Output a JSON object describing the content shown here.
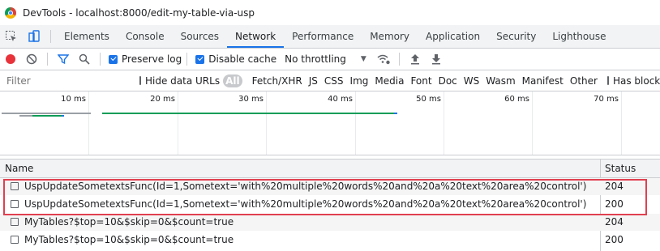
{
  "window": {
    "title": "DevTools - localhost:8000/edit-my-table-via-usp"
  },
  "tabs": [
    {
      "label": "Elements"
    },
    {
      "label": "Console"
    },
    {
      "label": "Sources"
    },
    {
      "label": "Network",
      "active": true
    },
    {
      "label": "Performance"
    },
    {
      "label": "Memory"
    },
    {
      "label": "Application"
    },
    {
      "label": "Security"
    },
    {
      "label": "Lighthouse"
    }
  ],
  "toolbar": {
    "preserve_log": {
      "label": "Preserve log",
      "checked": true
    },
    "disable_cache": {
      "label": "Disable cache",
      "checked": true
    },
    "throttling": "No throttling"
  },
  "filter": {
    "placeholder": "Filter",
    "hide_data_urls": {
      "label": "Hide data URLs",
      "checked": false
    },
    "types": [
      "All",
      "Fetch/XHR",
      "JS",
      "CSS",
      "Img",
      "Media",
      "Font",
      "Doc",
      "WS",
      "Wasm",
      "Manifest",
      "Other"
    ],
    "has_blocked": {
      "label": "Has block",
      "checked": false
    }
  },
  "overview": {
    "ticks": [
      "10 ms",
      "20 ms",
      "30 ms",
      "40 ms",
      "50 ms",
      "60 ms",
      "70 ms"
    ]
  },
  "table": {
    "headers": {
      "name": "Name",
      "status": "Status"
    },
    "rows": [
      {
        "name": "UspUpdateSometextsFunc(Id=1,Sometext='with%20multiple%20words%20and%20a%20text%20area%20control')",
        "status": "204"
      },
      {
        "name": "UspUpdateSometextsFunc(Id=1,Sometext='with%20multiple%20words%20and%20a%20text%20area%20control')",
        "status": "200"
      },
      {
        "name": "MyTables?$top=10&$skip=0&$count=true",
        "status": "204"
      },
      {
        "name": "MyTables?$top=10&$skip=0&$count=true",
        "status": "200"
      }
    ]
  },
  "colors": {
    "accent": "#1a73e8",
    "record": "#e8333b",
    "highlight": "#e04050",
    "waterfall_green": "#0f9d58"
  }
}
